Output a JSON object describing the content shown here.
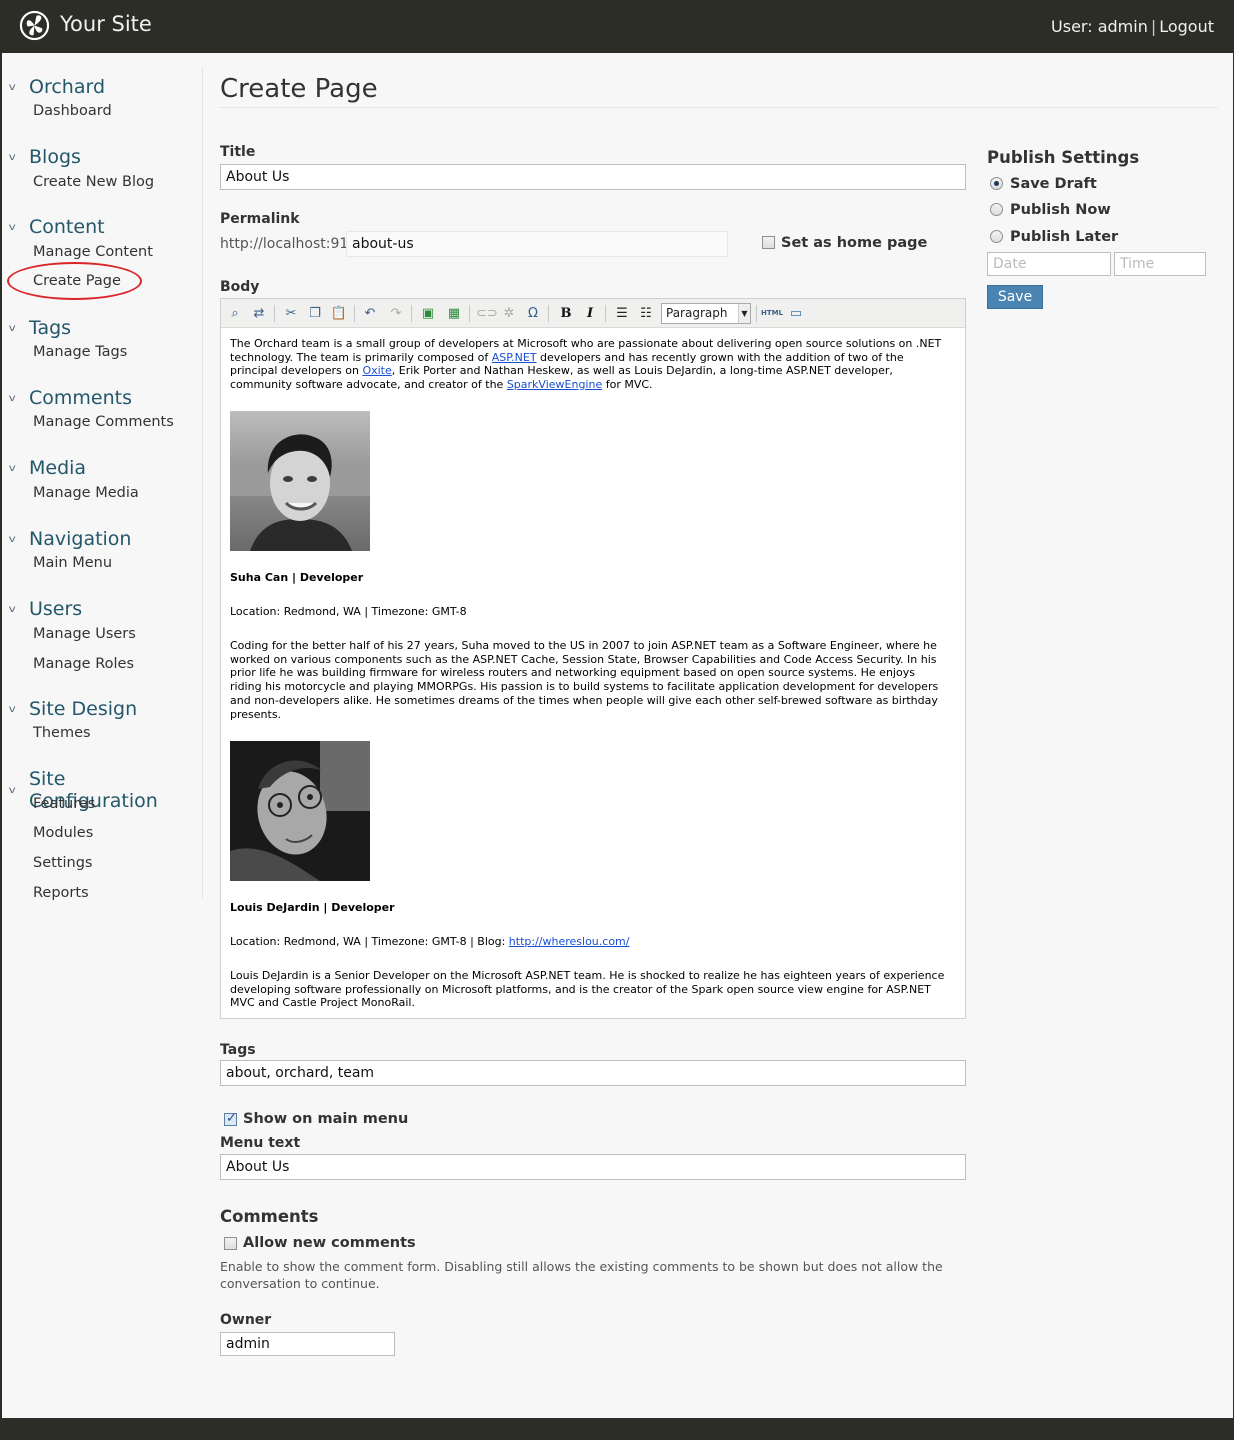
{
  "header": {
    "site_name": "Your Site",
    "user_label": "User: admin",
    "logout": "Logout"
  },
  "sidebar": {
    "sections": [
      {
        "title": "Orchard",
        "items": [
          "Dashboard"
        ]
      },
      {
        "title": "Blogs",
        "items": [
          "Create New Blog"
        ]
      },
      {
        "title": "Content",
        "items": [
          "Manage Content",
          "Create Page"
        ]
      },
      {
        "title": "Tags",
        "items": [
          "Manage Tags"
        ]
      },
      {
        "title": "Comments",
        "items": [
          "Manage Comments"
        ]
      },
      {
        "title": "Media",
        "items": [
          "Manage Media"
        ]
      },
      {
        "title": "Navigation",
        "items": [
          "Main Menu"
        ]
      },
      {
        "title": "Users",
        "items": [
          "Manage Users",
          "Manage Roles"
        ]
      },
      {
        "title": "Site Design",
        "items": [
          "Themes"
        ]
      },
      {
        "title": "Site Configuration",
        "items": [
          "Features",
          "Modules",
          "Settings",
          "Reports"
        ]
      }
    ]
  },
  "page": {
    "title": "Create Page",
    "title_label": "Title",
    "title_value": "About Us",
    "permalink_label": "Permalink",
    "permalink_prefix": "http://localhost:91/",
    "permalink_value": "about-us",
    "home_page_label": "Set as home page",
    "body_label": "Body",
    "tags_label": "Tags",
    "tags_value": "about, orchard, team",
    "show_menu_label": "Show on main menu",
    "menu_text_label": "Menu text",
    "menu_text_value": "About Us",
    "comments_heading": "Comments",
    "allow_comments_label": "Allow new comments",
    "comments_help": "Enable to show the comment form. Disabling still allows the existing comments to be shown but does not allow the conversation to continue.",
    "owner_label": "Owner",
    "owner_value": "admin"
  },
  "editor": {
    "format_value": "Paragraph",
    "intro_1": "The Orchard team is a small group of developers at Microsoft who are passionate about delivering open source solutions on .NET technology. The team is primarily composed of ",
    "link_aspnet": "ASP.NET",
    "intro_2": " developers and has recently grown with the addition of two of the principal developers on ",
    "link_oxite": "Oxite",
    "intro_3": ", Erik Porter and Nathan Heskew, as well as Louis DeJardin, a long-time ASP.NET developer, community software advocate, and creator of the ",
    "link_spark": "SparkViewEngine",
    "intro_4": " for MVC.",
    "person1_name": "Suha Can | Developer",
    "person1_location": "Location: Redmond, WA | Timezone: GMT-8",
    "person1_bio": "Coding for the better half of his 27 years, Suha moved to the US in 2007 to join ASP.NET team as a Software Engineer, where he worked on various components such as the ASP.NET Cache, Session State, Browser Capabilities and Code Access Security. In his prior life he was building firmware for wireless routers and networking equipment based on open source systems. He enjoys riding his motorcycle and playing MMORPGs. His passion is to build systems to facilitate application development for developers and non-developers alike. He sometimes dreams of the times when people will give each other self-brewed software as birthday presents.",
    "person2_name": "Louis DeJardin | Developer",
    "person2_location": "Location: Redmond, WA | Timezone: GMT-8 | Blog: ",
    "person2_blog": "http://whereslou.com/",
    "person2_bio": "Louis DeJardin is a Senior Developer on the Microsoft ASP.NET team. He is shocked to realize he has eighteen years of experience developing software professionally on Microsoft platforms, and is the creator of the Spark open source view engine for ASP.NET MVC and Castle Project MonoRail."
  },
  "publish": {
    "title": "Publish Settings",
    "options": [
      "Save Draft",
      "Publish Now",
      "Publish Later"
    ],
    "selected": "Save Draft",
    "date_placeholder": "Date",
    "time_placeholder": "Time",
    "save_label": "Save"
  },
  "colors": {
    "header_bg": "#2d2d28",
    "nav_link": "#23576a",
    "accent_button": "#4a84b3",
    "highlight_circle": "#d9262a"
  }
}
